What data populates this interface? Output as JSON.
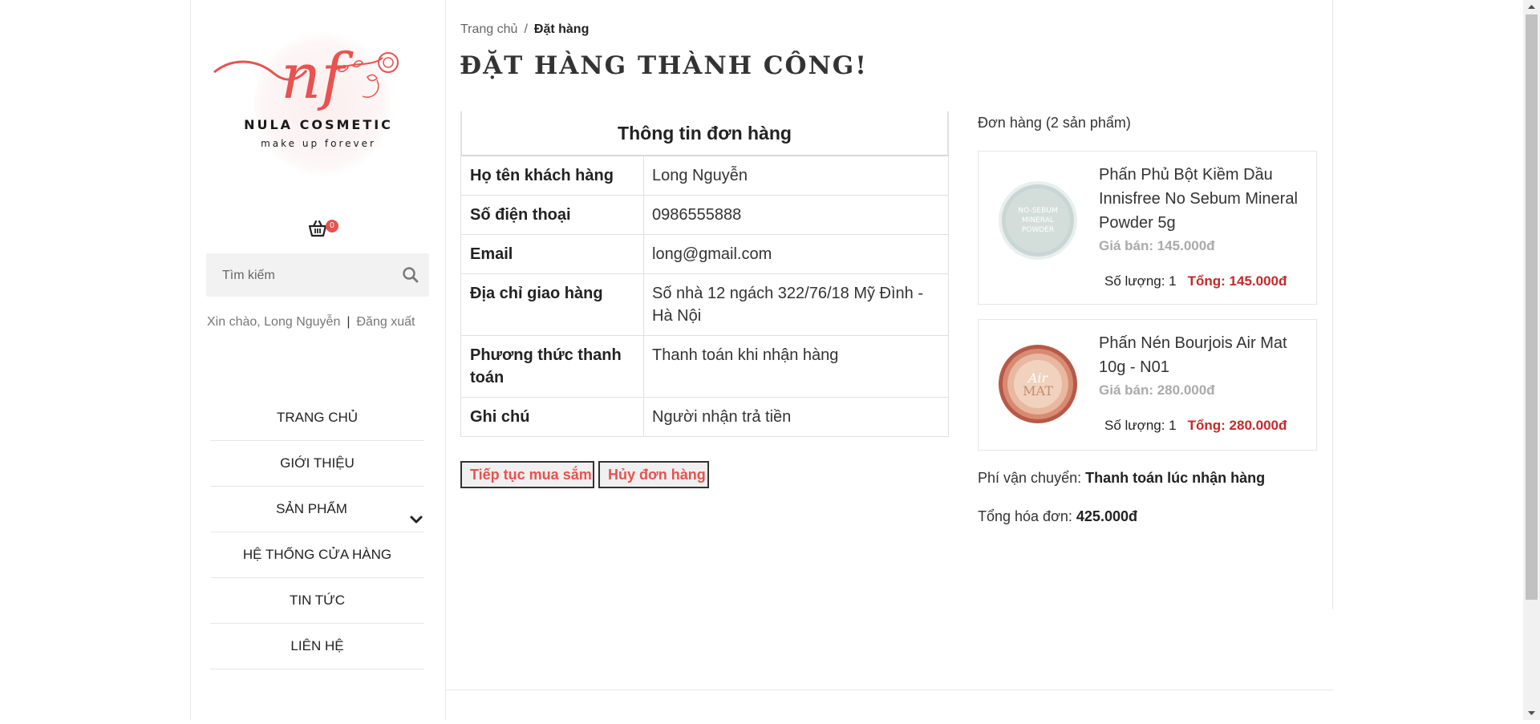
{
  "brand": {
    "name": "NULA COSMETIC",
    "tagline": "make up forever",
    "monogram": "nf",
    "accent": "#e8524f"
  },
  "cart": {
    "count": "0"
  },
  "search": {
    "placeholder": "Tìm kiếm"
  },
  "user": {
    "greeting": "Xin chào, Long Nguyễn",
    "separator": "|",
    "logout": "Đăng xuất"
  },
  "menu": [
    {
      "label": "TRANG CHỦ"
    },
    {
      "label": "GIỚI THIỆU"
    },
    {
      "label": "SẢN PHẨM",
      "icon": "chevron-down-icon"
    },
    {
      "label": "HỆ THỐNG CỬA HÀNG"
    },
    {
      "label": "TIN TỨC"
    },
    {
      "label": "LIÊN HỆ"
    }
  ],
  "breadcrumb": {
    "home": "Trang chủ",
    "separator": "/",
    "current": "Đặt hàng"
  },
  "page_title": "ĐẶT HÀNG THÀNH CÔNG!",
  "order_info": {
    "heading": "Thông tin đơn hàng",
    "rows": [
      {
        "label": "Họ tên khách hàng",
        "value": "Long Nguyễn"
      },
      {
        "label": "Số điện thoại",
        "value": "0986555888"
      },
      {
        "label": "Email",
        "value": "long@gmail.com"
      },
      {
        "label": "Địa chỉ giao hàng",
        "value": "Số nhà 12 ngách 322/76/18 Mỹ Đình - Hà Nội"
      },
      {
        "label": "Phương thức thanh toán",
        "value": "Thanh toán khi nhận hàng"
      },
      {
        "label": "Ghi chú",
        "value": "Người nhận trả tiền"
      }
    ]
  },
  "actions": {
    "continue": "Tiếp tục mua sắm",
    "cancel": "Hủy đơn hàng"
  },
  "order": {
    "heading": "Đơn hàng (2 sản phẩm)",
    "items": [
      {
        "name": "Phấn Phủ Bột Kiềm Dầu Innisfree No Sebum Mineral Powder 5g",
        "price": "Giá bán: 145.000đ",
        "quantity": "Số lượng: 1",
        "total": "Tổng: 145.000đ",
        "thumb_text": [
          "NO-SEBUM",
          "MINERAL",
          "POWDER"
        ]
      },
      {
        "name": "Phấn Nén Bourjois Air Mat 10g - N01",
        "price": "Giá bán: 280.000đ",
        "quantity": "Số lượng: 1",
        "total": "Tổng: 280.000đ",
        "thumb_text": [
          "Air",
          "MAT"
        ]
      }
    ],
    "shipping_label": "Phí vận chuyển:",
    "shipping_value": "Thanh toán lúc nhận hàng",
    "grand_label": "Tổng hóa đơn:",
    "grand_value": "425.000đ"
  }
}
